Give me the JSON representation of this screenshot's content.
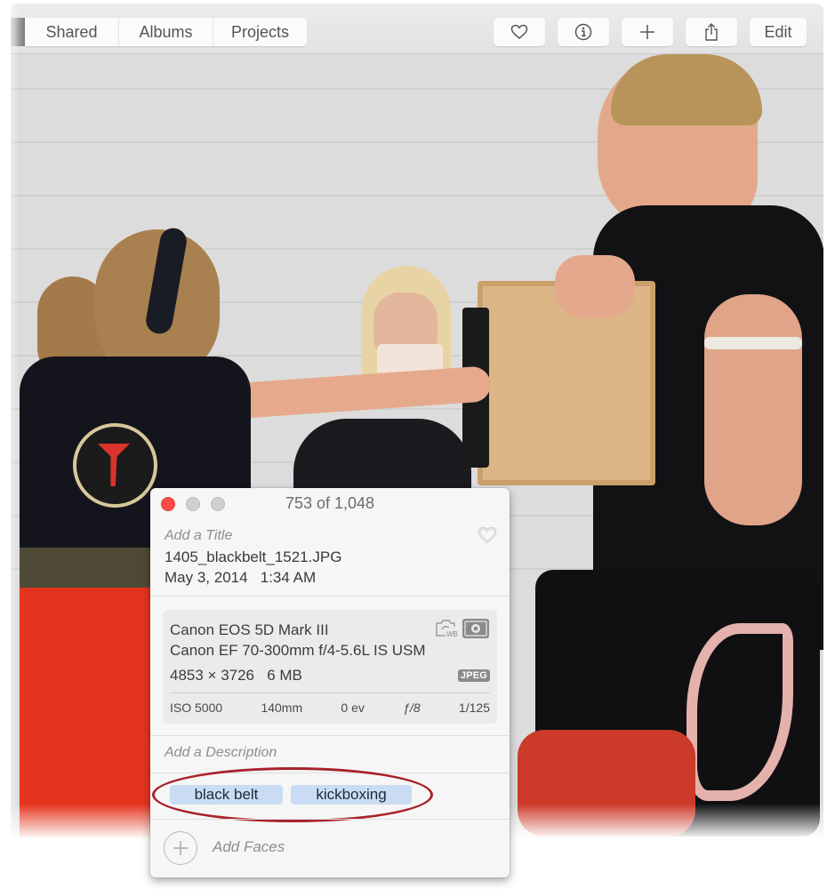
{
  "toolbar": {
    "segments": [
      {
        "label": "Shared"
      },
      {
        "label": "Albums"
      },
      {
        "label": "Projects"
      }
    ],
    "buttons": [
      {
        "icon": "heart-icon"
      },
      {
        "icon": "info-icon"
      },
      {
        "icon": "plus-icon"
      },
      {
        "icon": "share-icon"
      },
      {
        "label": "Edit"
      }
    ]
  },
  "photo": {
    "description": "Girl in black 'Master Tran' kickboxing shirt and red shorts punching a wooden board held by a man in black muay thai outfit; blonde woman photographing in background"
  },
  "info_panel": {
    "counter": "753 of 1,048",
    "title_placeholder": "Add a Title",
    "filename": "1405_blackbelt_1521.JPG",
    "date": "May 3, 2014",
    "time": "1:34 AM",
    "camera": "Canon EOS 5D Mark III",
    "lens": "Canon EF 70-300mm f/4-5.6L IS USM",
    "dimensions": "4853 × 3726",
    "file_size": "6 MB",
    "format_badge": "JPEG",
    "wb_label": "WB",
    "stats": {
      "iso": "ISO 5000",
      "focal_length": "140mm",
      "exposure_bias": "0 ev",
      "aperture": "ƒ/8",
      "shutter": "1/125"
    },
    "description_placeholder": "Add a Description",
    "keywords": [
      "black belt",
      "kickboxing"
    ],
    "add_faces_label": "Add Faces",
    "highlight_color": "#a9222b",
    "keyword_color": "#c9dcf3",
    "close_color": "#fc4b44"
  }
}
